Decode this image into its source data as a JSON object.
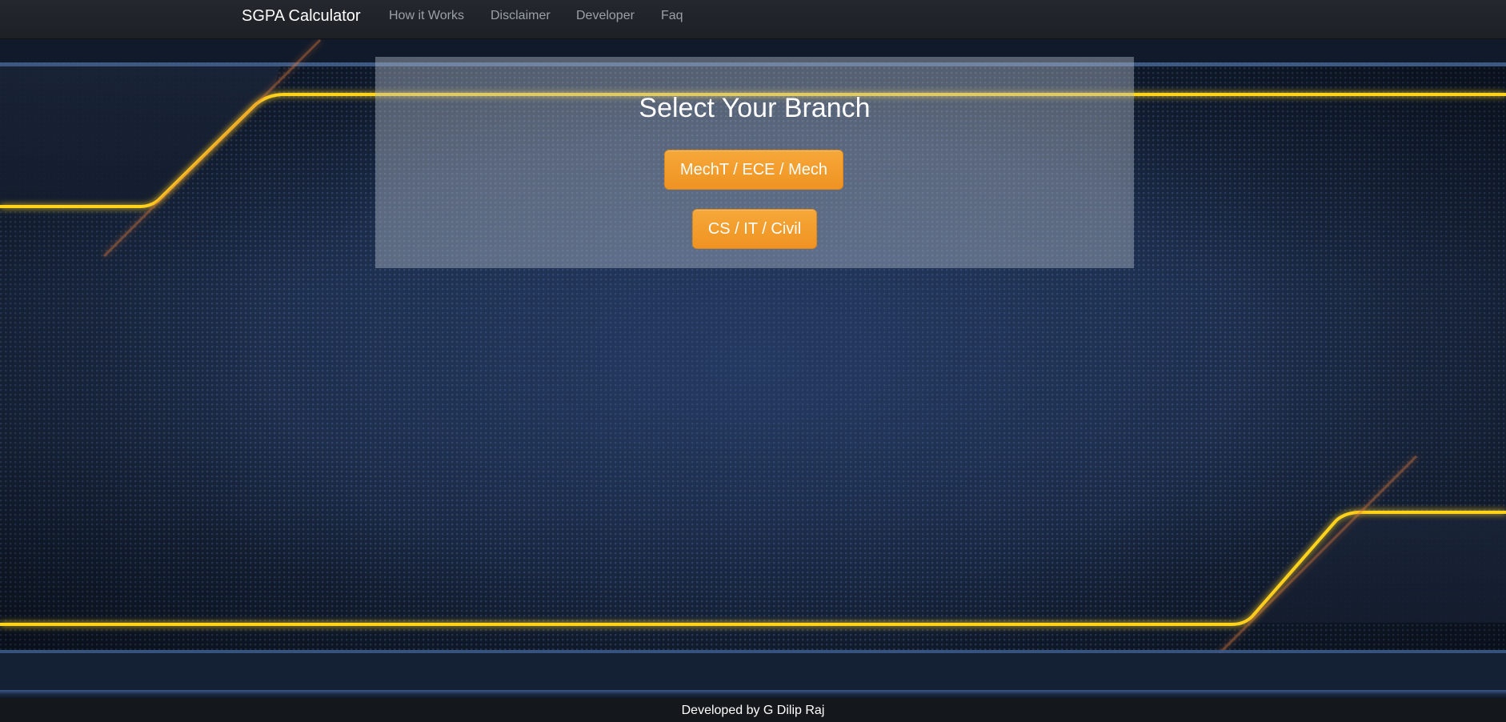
{
  "navbar": {
    "brand": "SGPA Calculator",
    "links": [
      "How it Works",
      "Disclaimer",
      "Developer",
      "Faq"
    ]
  },
  "panel": {
    "title": "Select Your Branch",
    "buttons": [
      "MechT / ECE / Mech",
      "CS / IT / Civil"
    ]
  },
  "footer": {
    "text": "Developed by G Dilip Raj"
  },
  "colors": {
    "accent": "#f0952a",
    "navbar": "#212529",
    "glow_line": "#ffd21f",
    "background": "#1a2840"
  }
}
